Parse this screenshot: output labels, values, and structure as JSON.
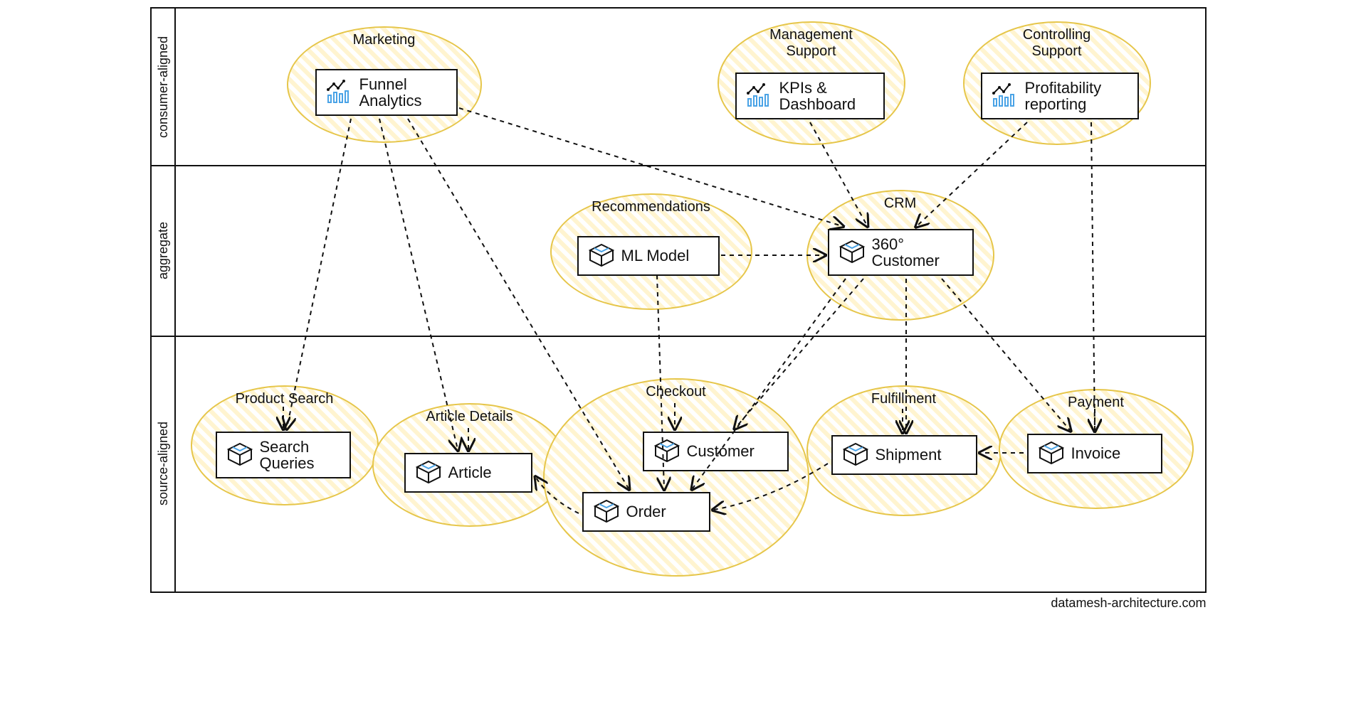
{
  "footer": "datamesh-architecture.com",
  "rows": {
    "consumer": "consumer-aligned",
    "aggregate": "aggregate",
    "source": "source-aligned"
  },
  "domains": {
    "marketing": "Marketing",
    "management": "Management\nSupport",
    "controlling": "Controlling\nSupport",
    "recommendations": "Recommendations",
    "crm": "CRM",
    "product_search": "Product Search",
    "article_details": "Article Details",
    "checkout": "Checkout",
    "fulfillment": "Fulfillment",
    "payment": "Payment"
  },
  "products": {
    "funnel": "Funnel\nAnalytics",
    "kpis": "KPIs &\nDashboard",
    "profitability": "Profitability\nreporting",
    "ml_model": "ML Model",
    "customer360": "360°\nCustomer",
    "search_queries": "Search\nQueries",
    "article": "Article",
    "customer": "Customer",
    "order": "Order",
    "shipment": "Shipment",
    "invoice": "Invoice"
  },
  "edges": [
    {
      "from": "funnel",
      "to": "search_queries"
    },
    {
      "from": "funnel",
      "to": "article"
    },
    {
      "from": "funnel",
      "to": "order"
    },
    {
      "from": "funnel",
      "to": "customer360"
    },
    {
      "from": "kpis",
      "to": "customer360"
    },
    {
      "from": "profitability",
      "to": "customer360"
    },
    {
      "from": "profitability",
      "to": "invoice"
    },
    {
      "from": "ml_model",
      "to": "customer360"
    },
    {
      "from": "ml_model",
      "to": "order"
    },
    {
      "from": "customer360",
      "to": "customer"
    },
    {
      "from": "customer360",
      "to": "order"
    },
    {
      "from": "customer360",
      "to": "shipment"
    },
    {
      "from": "customer360",
      "to": "invoice"
    },
    {
      "from": "shipment",
      "to": "order"
    },
    {
      "from": "invoice",
      "to": "shipment"
    },
    {
      "from": "order",
      "to": "article"
    }
  ],
  "icons": {
    "chart": "chart-icon",
    "box": "box-icon"
  },
  "colors": {
    "domain_stroke": "#e6c64a",
    "domain_fill": "#fff4d0",
    "accent": "#4aa3e6"
  }
}
